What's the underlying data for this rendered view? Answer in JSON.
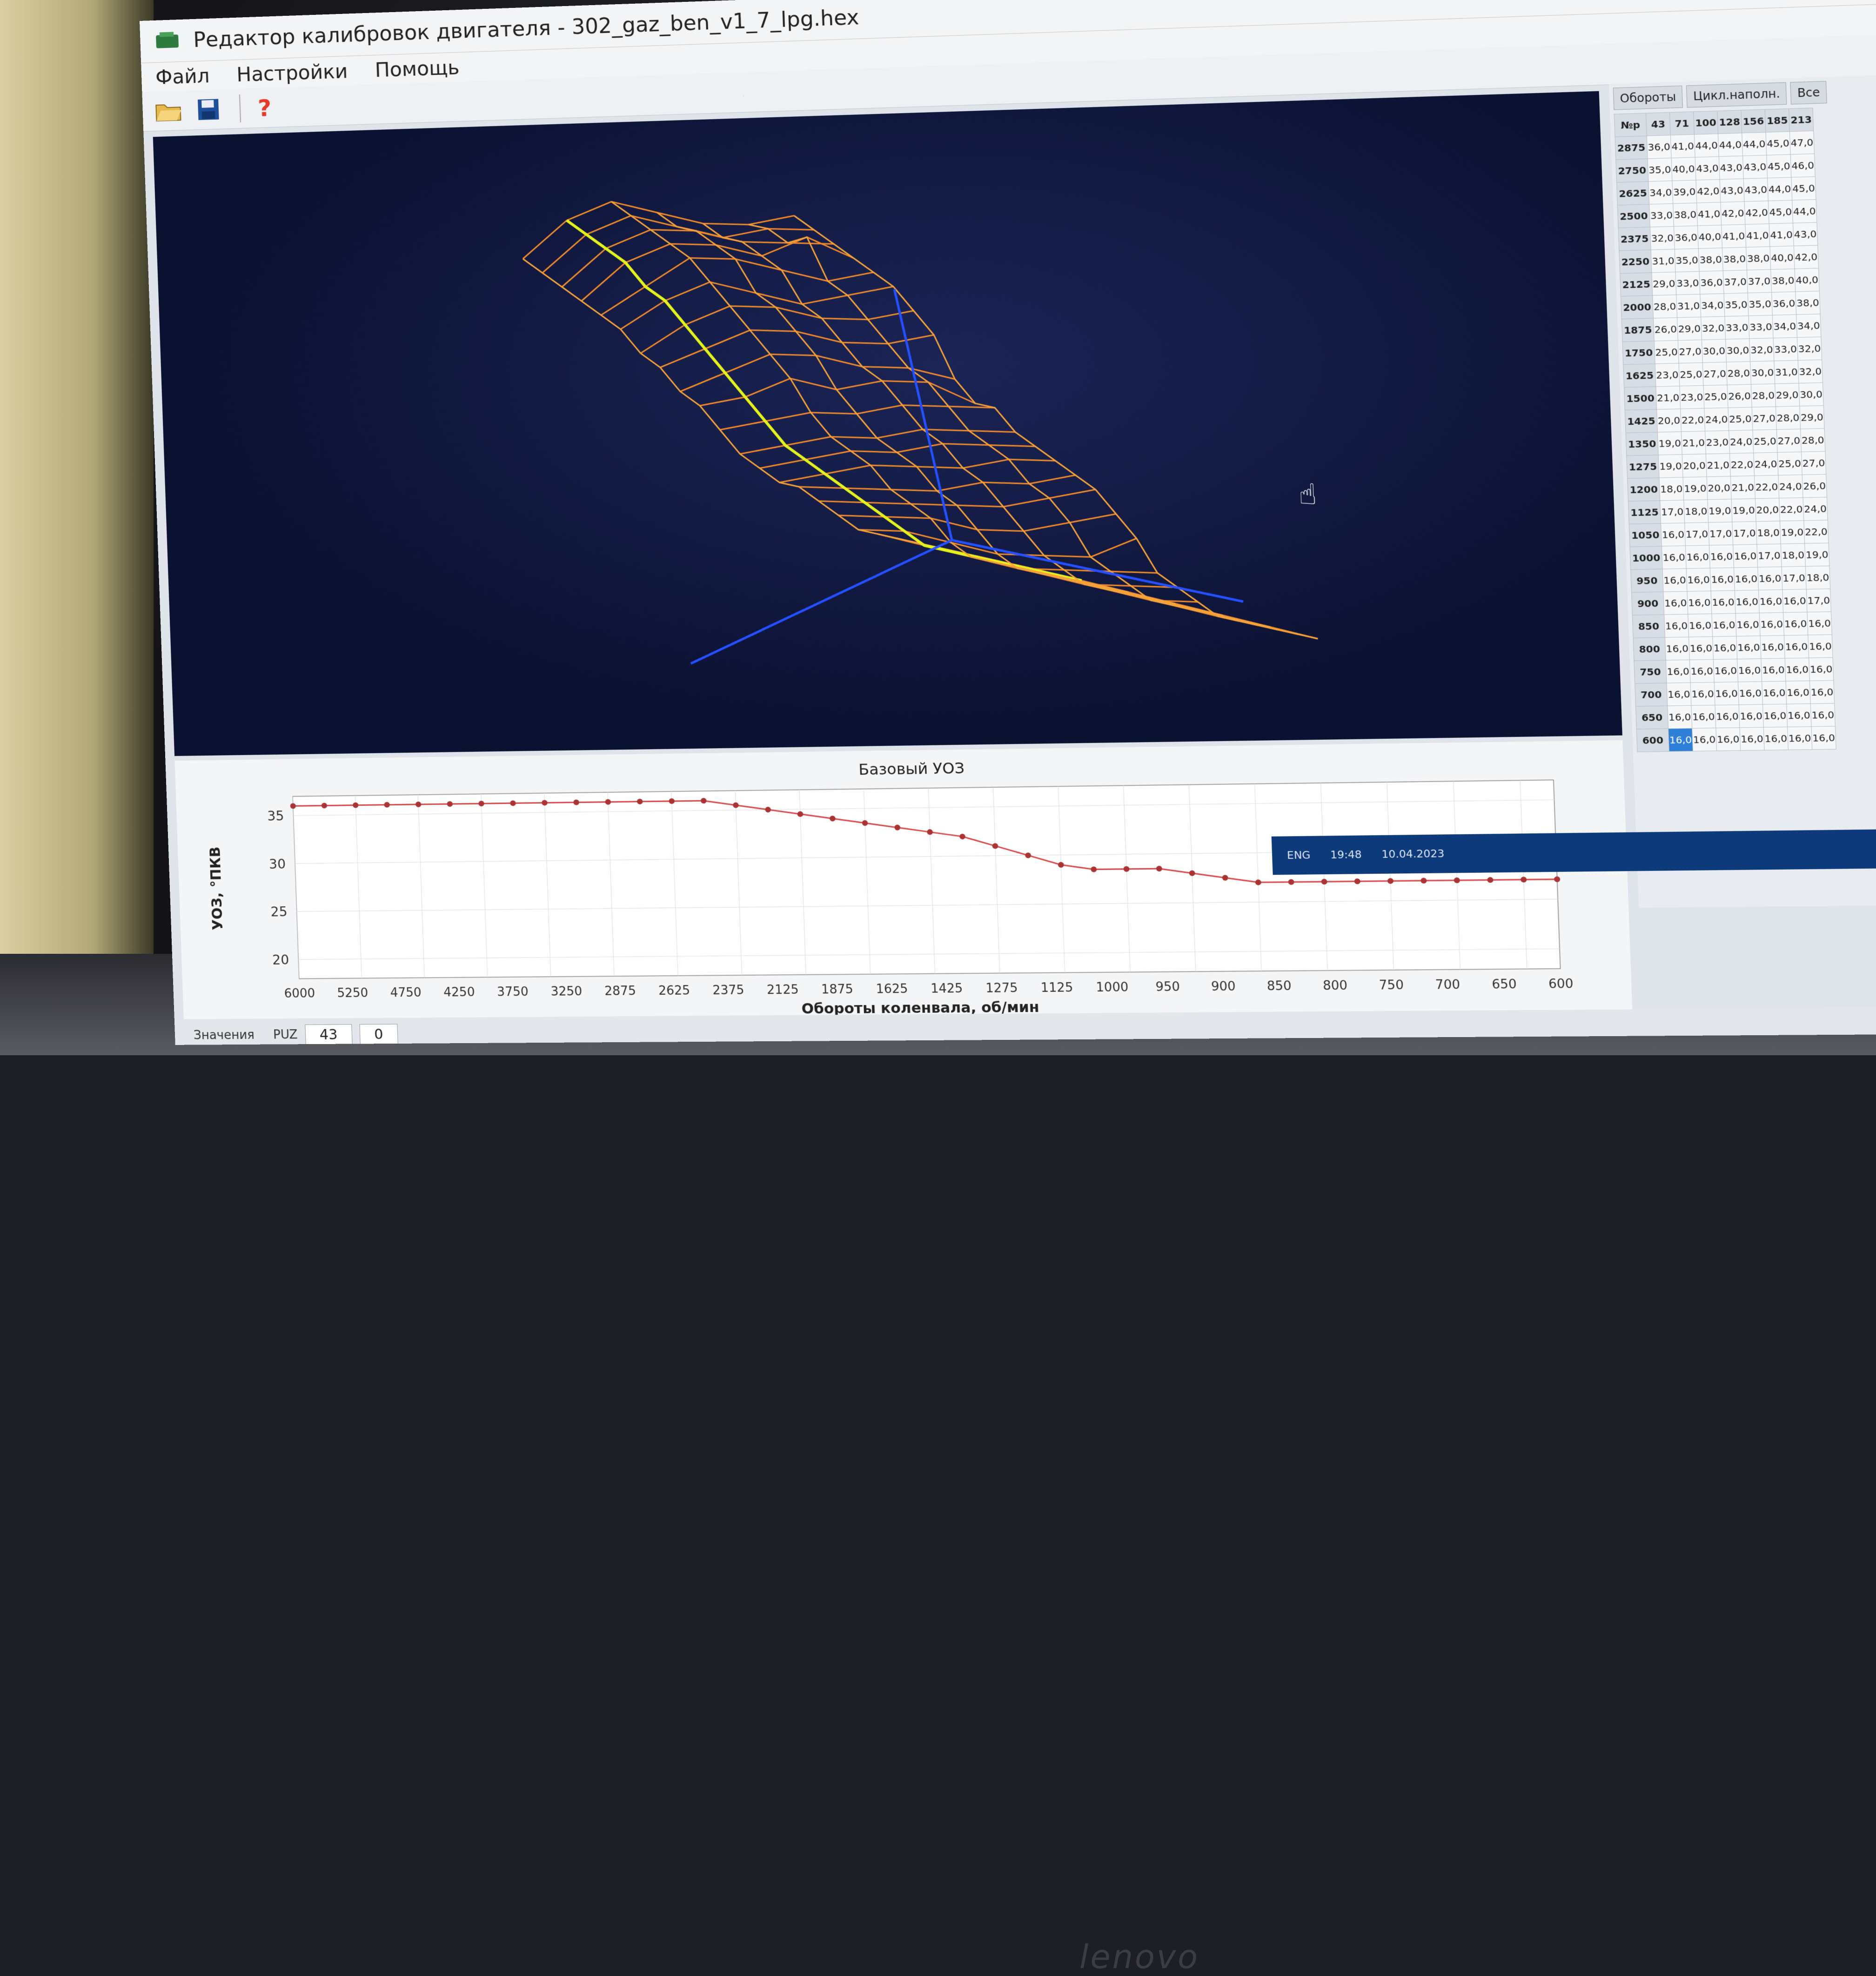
{
  "window": {
    "title": "Редактор калибровок двигателя - 302_gaz_ben_v1_7_lpg.hex",
    "controls": [
      "–",
      "□",
      "✕"
    ]
  },
  "menu": [
    "Файл",
    "Настройки",
    "Помощь"
  ],
  "toolbar": {
    "icons": [
      "open-folder-icon",
      "save-disk-icon",
      "help-question-icon"
    ]
  },
  "table_panel": {
    "axis_x_combo": "Обороты",
    "axis_y_combo": "Цикл.наполн.",
    "view_combo": "Все",
    "corner_header": "№р",
    "col_headers": [
      "43",
      "71",
      "100",
      "128",
      "156",
      "185",
      "213"
    ],
    "row_headers": [
      "2875",
      "2750",
      "2625",
      "2500",
      "2375",
      "2250",
      "2125",
      "2000",
      "1875",
      "1750",
      "1625",
      "1500",
      "1425",
      "1350",
      "1275",
      "1200",
      "1125",
      "1050",
      "1000",
      "950",
      "900",
      "850",
      "800",
      "750",
      "700",
      "650",
      "600"
    ],
    "cells": [
      [
        "36,0",
        "41,0",
        "44,0",
        "44,0",
        "44,0",
        "45,0",
        "47,0"
      ],
      [
        "35,0",
        "40,0",
        "43,0",
        "43,0",
        "43,0",
        "45,0",
        "46,0"
      ],
      [
        "34,0",
        "39,0",
        "42,0",
        "43,0",
        "43,0",
        "44,0",
        "45,0"
      ],
      [
        "33,0",
        "38,0",
        "41,0",
        "42,0",
        "42,0",
        "45,0",
        "44,0"
      ],
      [
        "32,0",
        "36,0",
        "40,0",
        "41,0",
        "41,0",
        "41,0",
        "43,0"
      ],
      [
        "31,0",
        "35,0",
        "38,0",
        "38,0",
        "38,0",
        "40,0",
        "42,0"
      ],
      [
        "29,0",
        "33,0",
        "36,0",
        "37,0",
        "37,0",
        "38,0",
        "40,0"
      ],
      [
        "28,0",
        "31,0",
        "34,0",
        "35,0",
        "35,0",
        "36,0",
        "38,0"
      ],
      [
        "26,0",
        "29,0",
        "32,0",
        "33,0",
        "33,0",
        "34,0",
        "34,0"
      ],
      [
        "25,0",
        "27,0",
        "30,0",
        "30,0",
        "32,0",
        "33,0",
        "32,0"
      ],
      [
        "23,0",
        "25,0",
        "27,0",
        "28,0",
        "30,0",
        "31,0",
        "32,0"
      ],
      [
        "21,0",
        "23,0",
        "25,0",
        "26,0",
        "28,0",
        "29,0",
        "30,0"
      ],
      [
        "20,0",
        "22,0",
        "24,0",
        "25,0",
        "27,0",
        "28,0",
        "29,0"
      ],
      [
        "19,0",
        "21,0",
        "23,0",
        "24,0",
        "25,0",
        "27,0",
        "28,0"
      ],
      [
        "19,0",
        "20,0",
        "21,0",
        "22,0",
        "24,0",
        "25,0",
        "27,0"
      ],
      [
        "18,0",
        "19,0",
        "20,0",
        "21,0",
        "22,0",
        "24,0",
        "26,0"
      ],
      [
        "17,0",
        "18,0",
        "19,0",
        "19,0",
        "20,0",
        "22,0",
        "24,0"
      ],
      [
        "16,0",
        "17,0",
        "17,0",
        "17,0",
        "18,0",
        "19,0",
        "22,0"
      ],
      [
        "16,0",
        "16,0",
        "16,0",
        "16,0",
        "17,0",
        "18,0",
        "19,0"
      ],
      [
        "16,0",
        "16,0",
        "16,0",
        "16,0",
        "16,0",
        "17,0",
        "18,0"
      ],
      [
        "16,0",
        "16,0",
        "16,0",
        "16,0",
        "16,0",
        "16,0",
        "17,0"
      ],
      [
        "16,0",
        "16,0",
        "16,0",
        "16,0",
        "16,0",
        "16,0",
        "16,0"
      ],
      [
        "16,0",
        "16,0",
        "16,0",
        "16,0",
        "16,0",
        "16,0",
        "16,0"
      ],
      [
        "16,0",
        "16,0",
        "16,0",
        "16,0",
        "16,0",
        "16,0",
        "16,0"
      ],
      [
        "16,0",
        "16,0",
        "16,0",
        "16,0",
        "16,0",
        "16,0",
        "16,0"
      ],
      [
        "16,0",
        "16,0",
        "16,0",
        "16,0",
        "16,0",
        "16,0",
        "16,0"
      ],
      [
        "16,0",
        "16,0",
        "16,0",
        "16,0",
        "16,0",
        "16,0",
        "16,0"
      ]
    ],
    "selected_cell": [
      26,
      0
    ]
  },
  "chart_data": {
    "type": "line",
    "title": "Базовый УОЗ",
    "xlabel": "Обороты коленвала, об/мин",
    "ylabel": "УОЗ, °ПКВ",
    "x_ticks": [
      "6000",
      "5250",
      "4750",
      "4250",
      "3750",
      "3250",
      "2875",
      "2625",
      "2375",
      "2125",
      "1875",
      "1625",
      "1425",
      "1275",
      "1125",
      "1000",
      "950",
      "900",
      "850",
      "800",
      "750",
      "700",
      "650",
      "600"
    ],
    "y_ticks": [
      20,
      25,
      30,
      35
    ],
    "ylim": [
      18,
      37
    ],
    "x": [
      "6000",
      "5750",
      "5500",
      "5250",
      "5000",
      "4750",
      "4500",
      "4250",
      "4000",
      "3750",
      "3500",
      "3250",
      "3000",
      "2875",
      "2750",
      "2625",
      "2500",
      "2375",
      "2250",
      "2125",
      "2000",
      "1875",
      "1750",
      "1625",
      "1500",
      "1425",
      "1350",
      "1275",
      "1200",
      "1125",
      "1050",
      "1000",
      "950",
      "900",
      "850",
      "800",
      "750",
      "700",
      "650",
      "600"
    ],
    "series": [
      {
        "values": [
          36,
          36,
          36,
          36,
          36,
          36,
          36,
          36,
          36,
          36,
          36,
          36,
          36,
          36,
          35.5,
          35,
          34.5,
          34,
          33.5,
          33,
          32.5,
          32,
          31,
          30,
          29,
          28.5,
          28.5,
          28.5,
          28,
          27.5,
          27,
          27,
          27,
          27,
          27,
          27,
          27,
          27,
          27,
          27
        ]
      }
    ],
    "grid": true
  },
  "status": {
    "values_tab": "Значения",
    "puz_label": "PUZ",
    "puz_value": "43",
    "second_value": "0"
  },
  "system_tray": {
    "lang": "ENG",
    "time": "19:48",
    "date": "10.04.2023"
  },
  "laptop_brand": "lenovo"
}
